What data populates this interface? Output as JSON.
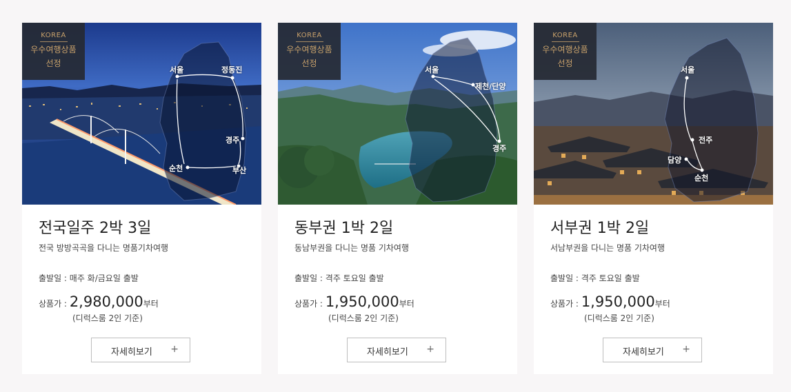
{
  "cards": [
    {
      "badge": {
        "line1": "KOREA",
        "line2": "우수여행상품",
        "line3": "선정"
      },
      "cities": [
        "서울",
        "정동진",
        "경주",
        "부산",
        "순천"
      ],
      "title": "전국일주 2박 3일",
      "subtitle": "전국 방방곡곡을 다니는 명품기차여행",
      "depart": "출발일 : 매주 화/금요일 출발",
      "price_label": "상품가 :",
      "price": "2,980,000",
      "price_suffix": "부터",
      "basis": "(디럭스룸 2인 기준)",
      "button": "자세히보기",
      "button_icon": "+"
    },
    {
      "badge": {
        "line1": "KOREA",
        "line2": "우수여행상품",
        "line3": "선정"
      },
      "cities": [
        "서울",
        "제천/단양",
        "경주"
      ],
      "title": "동부권 1박 2일",
      "subtitle": "동남부권을 다니는 명품 기차여행",
      "depart": "출발일 : 격주 토요일 출발",
      "price_label": "상품가 :",
      "price": "1,950,000",
      "price_suffix": "부터",
      "basis": "(디럭스룸 2인 기준)",
      "button": "자세히보기",
      "button_icon": "+"
    },
    {
      "badge": {
        "line1": "KOREA",
        "line2": "우수여행상품",
        "line3": "선정"
      },
      "cities": [
        "서울",
        "전주",
        "담양",
        "순천"
      ],
      "title": "서부권 1박 2일",
      "subtitle": "서남부권을 다니는 명품 기차여행",
      "depart": "출발일 : 격주 토요일 출발",
      "price_label": "상품가 :",
      "price": "1,950,000",
      "price_suffix": "부터",
      "basis": "(디럭스룸 2인 기준)",
      "button": "자세히보기",
      "button_icon": "+"
    }
  ]
}
